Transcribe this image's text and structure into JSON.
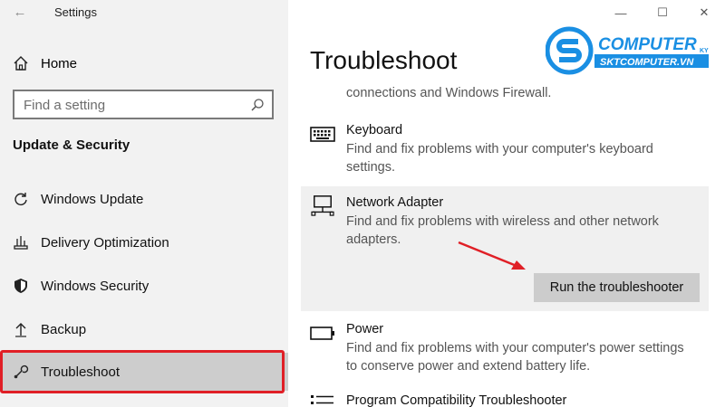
{
  "window": {
    "app_title": "Settings",
    "back_icon": "back-arrow-icon",
    "controls": {
      "minimize": "—",
      "maximize": "☐",
      "close": "✕"
    }
  },
  "sidebar": {
    "home_label": "Home",
    "search": {
      "placeholder": "Find a setting"
    },
    "section_title": "Update & Security",
    "items": [
      {
        "label": "Windows Update",
        "icon": "refresh-icon"
      },
      {
        "label": "Delivery Optimization",
        "icon": "delivery-icon"
      },
      {
        "label": "Windows Security",
        "icon": "shield-icon"
      },
      {
        "label": "Backup",
        "icon": "upload-icon"
      },
      {
        "label": "Troubleshoot",
        "icon": "wrench-icon",
        "active": true
      }
    ]
  },
  "main": {
    "title": "Troubleshoot",
    "partial_description": "connections and Windows Firewall.",
    "troubleshooters": [
      {
        "name": "Keyboard",
        "description": "Find and fix problems with your computer's keyboard settings.",
        "desc_line1": "Find and fix problems with your computer's keyboard",
        "desc_line2": "settings.",
        "icon": "keyboard-icon"
      },
      {
        "name": "Network Adapter",
        "description": "Find and fix problems with wireless and other network adapters.",
        "desc_line1": "Find and fix problems with wireless and other network",
        "desc_line2": "adapters.",
        "icon": "network-adapter-icon",
        "expanded": true,
        "button_label": "Run the troubleshooter"
      },
      {
        "name": "Power",
        "description": "Find and fix problems with your computer's power settings to conserve power and extend battery life.",
        "desc_line1": "Find and fix problems with your computer's power settings",
        "desc_line2": "to conserve power and extend battery life.",
        "icon": "battery-icon"
      },
      {
        "name": "Program Compatibility Troubleshooter",
        "icon": "list-icon"
      }
    ]
  },
  "watermark": {
    "brand": "COMPUTER",
    "small": "KY",
    "site": "SKTCOMPUTER.VN"
  },
  "colors": {
    "highlight_outline": "#e01f26",
    "arrow": "#e01f26",
    "logo_blue": "#1a8fe3"
  }
}
